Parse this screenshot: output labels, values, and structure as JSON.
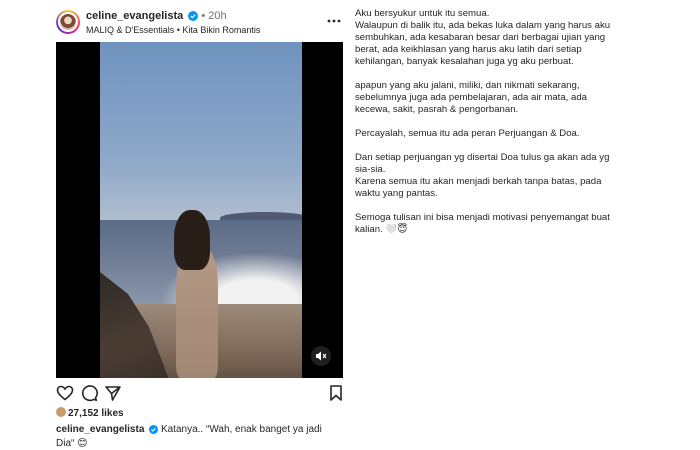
{
  "post": {
    "username": "celine_evangelista",
    "separator": "•",
    "time": "20h",
    "audio": "MALIQ & D'Essentials • Kita Bikin Romantis",
    "likes": "27,152 likes",
    "caption_user": "celine_evangelista",
    "caption_line1": "Katanya.. “Wah, enak banget ya jadi",
    "caption_line2": "Dia“",
    "caption_emoji": "😊"
  },
  "icons": {
    "verified": "verified-badge-icon",
    "more": "more-options-icon",
    "like": "heart-icon",
    "comment": "comment-icon",
    "share": "send-icon",
    "save": "bookmark-icon",
    "mute": "muted-speaker-icon",
    "verified_color": "#0095f6"
  },
  "text_panel": {
    "paragraphs": [
      [
        "Aku bersyukur untuk itu semua.",
        "Walaupun di balik itu, ada bekas luka dalam yang harus aku",
        "sembuhkan, ada kesabaran besar dari berbagai ujian yang",
        "berat, ada keikhlasan yang harus aku latih dari setiap",
        "kehilangan, banyak kesalahan juga yg aku perbuat."
      ],
      [
        "apapun yang aku jalani, miliki, dan nikmati sekarang,",
        "sebelumnya juga ada pembelajaran, ada air mata, ada",
        "kecewa, sakit, pasrah & pengorbanan."
      ],
      [
        "Percayalah, semua itu ada peran Perjuangan & Doa."
      ],
      [
        "Dan setiap perjuangan yg disertai Doa tulus ga akan ada yg",
        "sia-sia.",
        "Karena semua itu akan menjadi berkah tanpa batas, pada",
        "waktu yang pantas."
      ],
      [
        "Semoga tulisan ini bisa menjadi motivasi penyemangat buat",
        "kalian."
      ]
    ],
    "closing_emoji": "🤍😇"
  }
}
